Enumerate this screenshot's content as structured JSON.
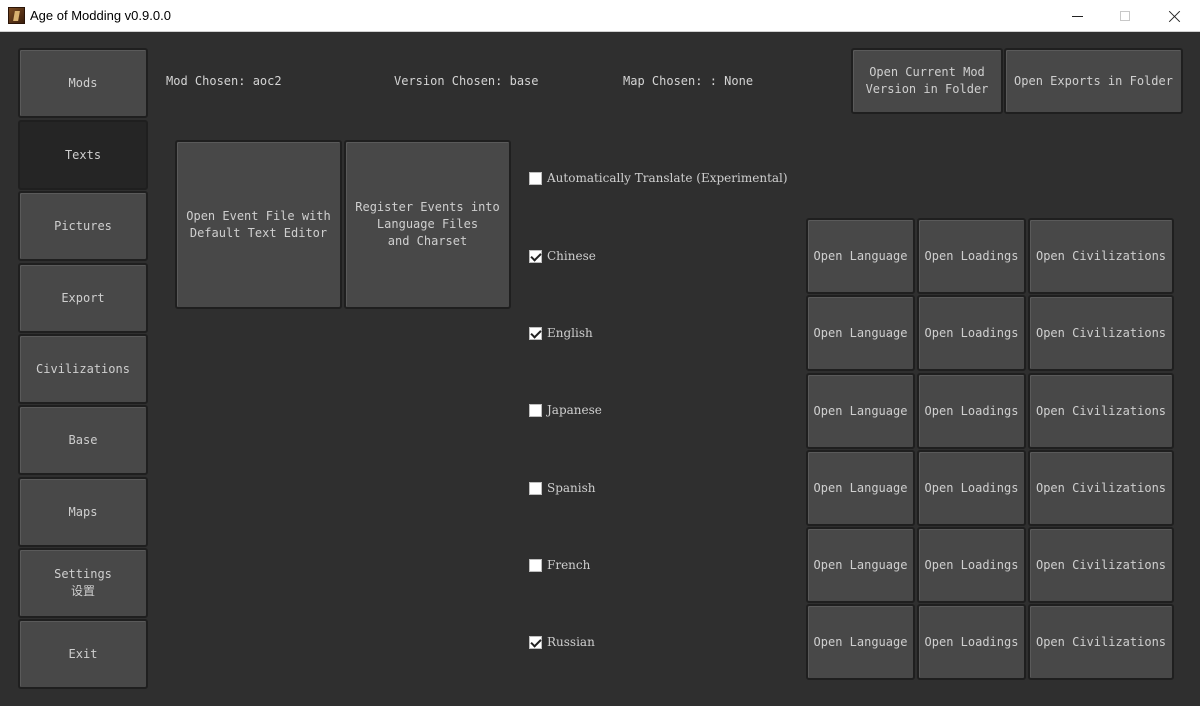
{
  "window": {
    "title": "Age of Modding v0.9.0.0",
    "icon": "app-icon"
  },
  "sidebar": {
    "items": [
      {
        "label": "Mods",
        "active": false
      },
      {
        "label": "Texts",
        "active": true
      },
      {
        "label": "Pictures",
        "active": false
      },
      {
        "label": "Export",
        "active": false
      },
      {
        "label": "Civilizations",
        "active": false
      },
      {
        "label": "Base",
        "active": false
      },
      {
        "label": "Maps",
        "active": false
      },
      {
        "label": "Settings\n设置",
        "active": false
      },
      {
        "label": "Exit",
        "active": false
      }
    ]
  },
  "header": {
    "mod_chosen": "Mod Chosen: aoc2",
    "version_chosen": "Version Chosen: base",
    "map_chosen": "Map Chosen: : None",
    "open_current_mod": "Open Current Mod\nVersion in Folder",
    "open_exports": "Open Exports in Folder"
  },
  "actions": {
    "open_event_file": "Open Event File with\nDefault Text Editor",
    "register_events": "Register Events into\nLanguage Files\nand Charset"
  },
  "auto_translate": {
    "label": "Automatically Translate (Experimental)",
    "checked": false
  },
  "languages": [
    {
      "name": "Chinese",
      "checked": true,
      "open_language": "Open Language",
      "open_loadings": "Open Loadings",
      "open_civilizations": "Open Civilizations"
    },
    {
      "name": "English",
      "checked": true,
      "open_language": "Open Language",
      "open_loadings": "Open Loadings",
      "open_civilizations": "Open Civilizations"
    },
    {
      "name": "Japanese",
      "checked": false,
      "open_language": "Open Language",
      "open_loadings": "Open Loadings",
      "open_civilizations": "Open Civilizations"
    },
    {
      "name": "Spanish",
      "checked": false,
      "open_language": "Open Language",
      "open_loadings": "Open Loadings",
      "open_civilizations": "Open Civilizations"
    },
    {
      "name": "French",
      "checked": false,
      "open_language": "Open Language",
      "open_loadings": "Open Loadings",
      "open_civilizations": "Open Civilizations"
    },
    {
      "name": "Russian",
      "checked": true,
      "open_language": "Open Language",
      "open_loadings": "Open Loadings",
      "open_civilizations": "Open Civilizations"
    }
  ],
  "colors": {
    "background": "#2f2f2f",
    "button": "#484848",
    "button_active": "#252525",
    "text": "#cfcfcf"
  }
}
